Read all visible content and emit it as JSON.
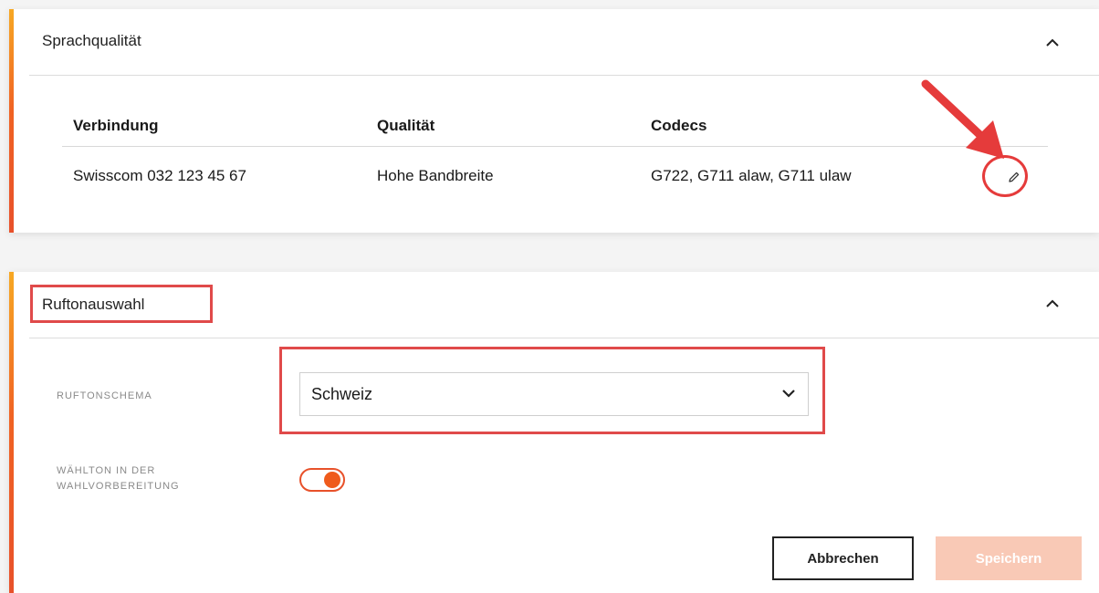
{
  "sections": {
    "voice_quality": {
      "title": "Sprachqualität",
      "table": {
        "headers": [
          "Verbindung",
          "Qualität",
          "Codecs"
        ],
        "rows": [
          [
            "Swisscom 032 123 45 67",
            "Hohe Bandbreite",
            "G722, G711 alaw, G711 ulaw"
          ]
        ]
      },
      "row_action_icon": "pencil-icon"
    },
    "ringtone": {
      "title": "Ruftonauswahl",
      "scheme_label": "RUFTONSCHEMA",
      "scheme_value": "Schweiz",
      "dialtone_label_line1": "WÄHLTON IN DER",
      "dialtone_label_line2": "WAHLVORBEREITUNG",
      "dialtone_enabled": true,
      "cancel_label": "Abbrechen",
      "save_label": "Speichern"
    }
  },
  "icons": {
    "collapse": "chevron-up-icon",
    "dropdown": "chevron-down-icon",
    "edit": "pencil-icon"
  },
  "colors": {
    "accent": "#ef5b1c",
    "annotation": "#e53b3b",
    "save_disabled": "#f9c9b6"
  }
}
